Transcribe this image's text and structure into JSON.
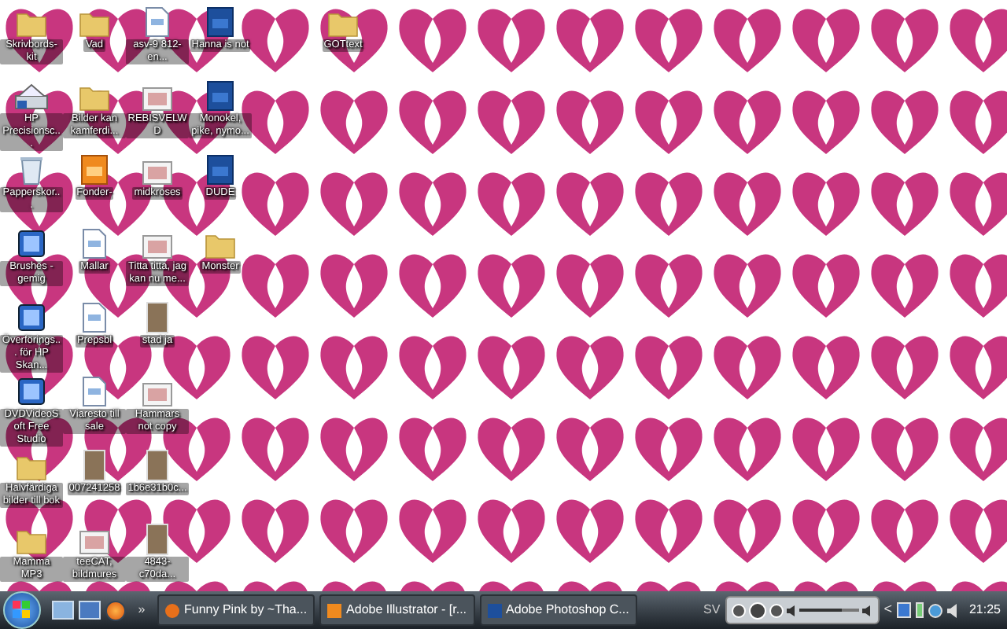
{
  "desktop_icons": [
    {
      "label": "Skrivbords-kit",
      "kind": "folder"
    },
    {
      "label": "HP Precisionsc...",
      "kind": "scanner"
    },
    {
      "label": "Papperskor...",
      "kind": "trash"
    },
    {
      "label": "Brushes - gemig",
      "kind": "app"
    },
    {
      "label": "Överförings... för HP Skan...",
      "kind": "app"
    },
    {
      "label": "DVDVideoSoft Free Studio",
      "kind": "app"
    },
    {
      "label": "Halvfärdiga bilder till bok",
      "kind": "folder"
    },
    {
      "label": "Mamma MP3",
      "kind": "folder"
    },
    {
      "label": "Vad",
      "kind": "folder"
    },
    {
      "label": "Bilder kan kamferdi...",
      "kind": "folder"
    },
    {
      "label": "Fonder-",
      "kind": "ai"
    },
    {
      "label": "Mallar",
      "kind": "doc"
    },
    {
      "label": "Prepsbl",
      "kind": "doc"
    },
    {
      "label": "Viaresto till sale",
      "kind": "doc"
    },
    {
      "label": "007241258",
      "kind": "photo"
    },
    {
      "label": "teeCAT, bildmures",
      "kind": "image"
    },
    {
      "label": "asv-9 812-en...",
      "kind": "doc"
    },
    {
      "label": "REBISVELWD",
      "kind": "image"
    },
    {
      "label": "midkroses",
      "kind": "image"
    },
    {
      "label": "Titta titta, jag kan nu me...",
      "kind": "image"
    },
    {
      "label": "stad ja",
      "kind": "photo"
    },
    {
      "label": "Hammars not copy",
      "kind": "image"
    },
    {
      "label": "1b6e31b0c...",
      "kind": "photo"
    },
    {
      "label": "4843-c70da...",
      "kind": "photo"
    },
    {
      "label": "Hanna is not",
      "kind": "ps"
    },
    {
      "label": "Monokel, pike, nymo...",
      "kind": "ps"
    },
    {
      "label": "DUDE",
      "kind": "ps"
    },
    {
      "label": "Monster",
      "kind": "folder"
    }
  ],
  "far_icons": [
    {
      "label": "GOTtext",
      "kind": "folder"
    }
  ],
  "taskbar": {
    "overflow": "»",
    "windows": [
      {
        "title": "Funny Pink by ~Tha...",
        "kind": "browser",
        "selected": false
      },
      {
        "title": "Adobe Illustrator - [r...",
        "kind": "ai",
        "selected": false
      },
      {
        "title": "Adobe Photoshop C...",
        "kind": "ps",
        "selected": false
      }
    ],
    "language": "SV",
    "back": "<",
    "volume": {
      "level": 0.72
    },
    "clock": "21:25"
  }
}
